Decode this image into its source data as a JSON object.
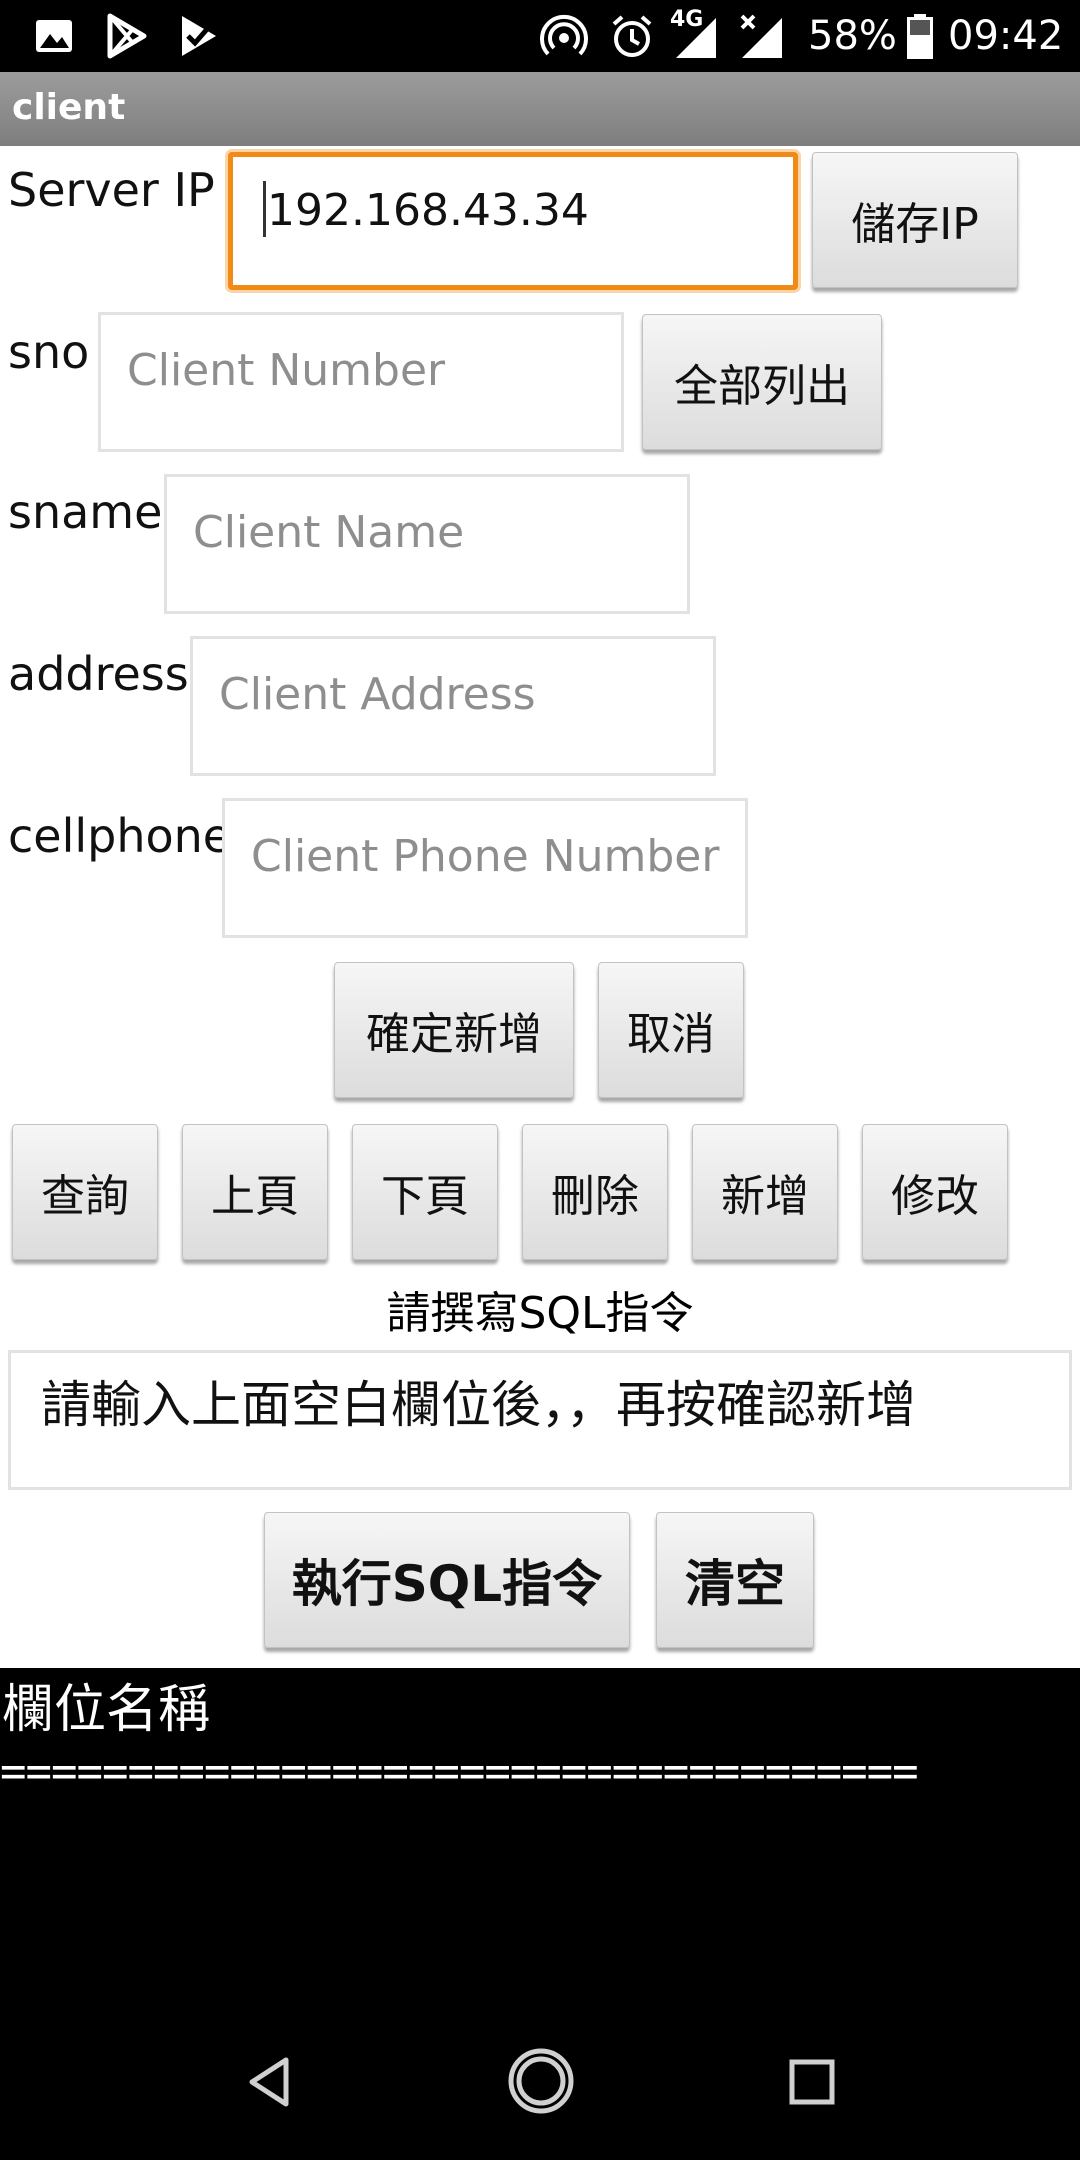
{
  "status_bar": {
    "icons": [
      "image-icon",
      "play-store-icon",
      "download-check-icon",
      "hotspot-icon",
      "alarm-icon",
      "signal-4g-icon",
      "signal-x-icon",
      "battery-icon"
    ],
    "network": "4G",
    "battery": "58%",
    "time": "09:42"
  },
  "app": {
    "title": "client"
  },
  "server": {
    "label": "Server IP",
    "value": "192.168.43.34",
    "save_button": "儲存IP"
  },
  "form": {
    "sno": {
      "label": "sno",
      "placeholder": "Client Number"
    },
    "list_all_button": "全部列出",
    "sname": {
      "label": "sname",
      "placeholder": "Client Name"
    },
    "address": {
      "label": "address",
      "placeholder": "Client Address"
    },
    "cellphone": {
      "label": "cellphone",
      "placeholder": "Client Phone Number"
    },
    "confirm_add_button": "確定新增",
    "cancel_button": "取消"
  },
  "toolbar": {
    "query": "查詢",
    "prev_page": "上頁",
    "next_page": "下頁",
    "delete": "刪除",
    "add": "新增",
    "modify": "修改"
  },
  "sql": {
    "caption": "請撰寫SQL指令",
    "input_value": "請輸入上面空白欄位後，，再按確認新增",
    "execute_button": "執行SQL指令",
    "clear_button": "清空"
  },
  "output": {
    "header": "欄位名稱",
    "separator": "===================================="
  },
  "nav": {
    "icons": [
      "back-icon",
      "home-icon",
      "recents-icon"
    ]
  },
  "colors": {
    "focus": "#f28a16",
    "title_bar": "#8a8a8a",
    "console_bg": "#000000"
  }
}
